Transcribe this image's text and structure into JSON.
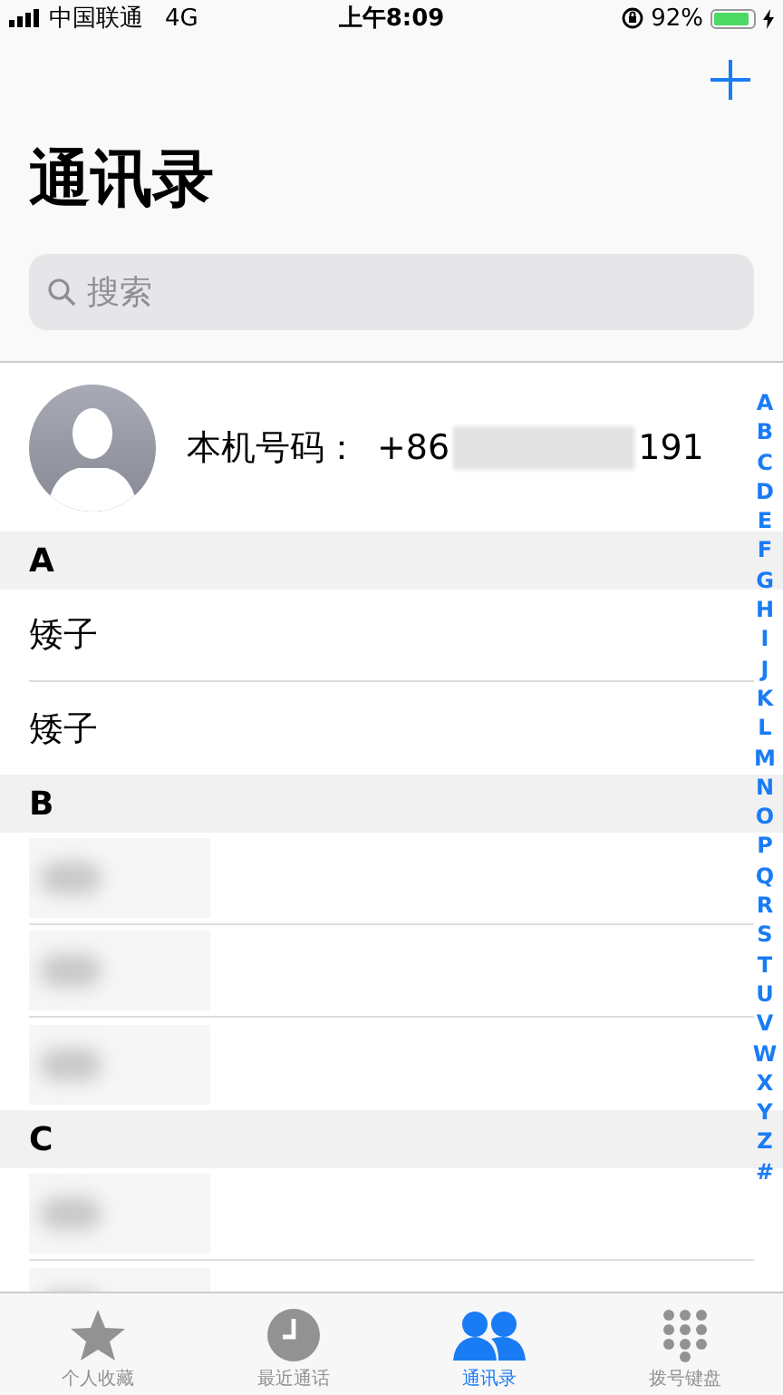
{
  "status_bar": {
    "carrier": "中国联通",
    "network": "4G",
    "time": "上午8:09",
    "battery": "92%"
  },
  "title": "通讯录",
  "search": {
    "placeholder": "搜索"
  },
  "my_card": {
    "label": "本机号码：",
    "number_prefix": "+86",
    "number_suffix": "191"
  },
  "sections": [
    {
      "letter": "A",
      "rows": [
        {
          "kind": "name",
          "name": "矮子"
        },
        {
          "kind": "name",
          "name": "矮子"
        }
      ]
    },
    {
      "letter": "B",
      "rows": [
        {
          "kind": "redacted"
        },
        {
          "kind": "redacted"
        },
        {
          "kind": "redacted"
        }
      ]
    },
    {
      "letter": "C",
      "rows": [
        {
          "kind": "redacted"
        },
        {
          "kind": "redacted"
        }
      ]
    }
  ],
  "index": [
    "A",
    "B",
    "C",
    "D",
    "E",
    "F",
    "G",
    "H",
    "I",
    "J",
    "K",
    "L",
    "M",
    "N",
    "O",
    "P",
    "Q",
    "R",
    "S",
    "T",
    "U",
    "V",
    "W",
    "X",
    "Y",
    "Z",
    "#"
  ],
  "tabs": [
    {
      "kind": "favorites",
      "label": "个人收藏",
      "selected": false
    },
    {
      "kind": "recents",
      "label": "最近通话",
      "selected": false
    },
    {
      "kind": "contacts",
      "label": "通讯录",
      "selected": true
    },
    {
      "kind": "keypad",
      "label": "拨号键盘",
      "selected": false
    }
  ]
}
